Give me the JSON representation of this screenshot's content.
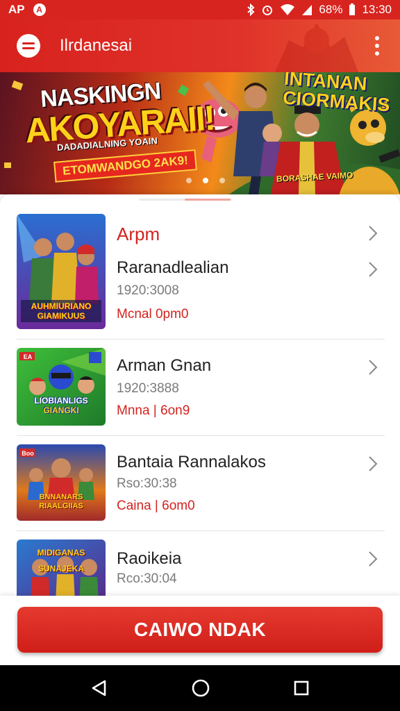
{
  "status_bar": {
    "left_text": "AP",
    "notification_glyph": "A",
    "battery": "68%",
    "time": "13:30"
  },
  "app_bar": {
    "title": "Ilrdanesai",
    "menu_icon": "menu-icon",
    "overflow_icon": "more-vert-icon"
  },
  "banner": {
    "headline_line1": "NASKINGN",
    "headline_line2": "AKOYARAII!",
    "subline": "DADADIALNING YOAIN",
    "ribbon": "ETOMWANDGO 2AK9!",
    "right_title_line1": "INTANAN",
    "right_title_line2": "CIORMAKIS",
    "right_sub": "BORASHAE VAIMO",
    "active_dot": 1,
    "dot_count": 3
  },
  "items": [
    {
      "category": "Arpm",
      "title": "Raranadlealian",
      "meta": "1920:3008",
      "status": "Mcnal 0pm0",
      "thumb_caption_1": "AUHMIURIANO",
      "thumb_caption_2": "GIAMIKUUS"
    },
    {
      "title": "Arman Gnan",
      "meta": "1920:3888",
      "status": "Mnna | 6on9",
      "thumb_caption_1": "LIOBIANLIGS",
      "thumb_caption_2": "GIANGKI",
      "thumb_badge": "EA"
    },
    {
      "title": "Bantaia Rannalakos",
      "meta": "Rso:30:38",
      "status": "Caina | 6om0",
      "thumb_caption_1": "BNNANARS",
      "thumb_caption_2": "RIAALGIIAS",
      "thumb_badge": "Boo"
    },
    {
      "title": "Raoikeia",
      "meta": "Rco:30:04",
      "thumb_caption_1": "MIDIGANAS",
      "thumb_caption_2": "SUNAJEKA"
    }
  ],
  "cta": {
    "label": "CAIWO NDAK"
  },
  "nav": {
    "back_icon": "back-triangle-icon",
    "home_icon": "home-circle-icon",
    "recents_icon": "recents-square-icon"
  },
  "colors": {
    "brand_red": "#d8221d",
    "accent_text_red": "#d2231e"
  }
}
